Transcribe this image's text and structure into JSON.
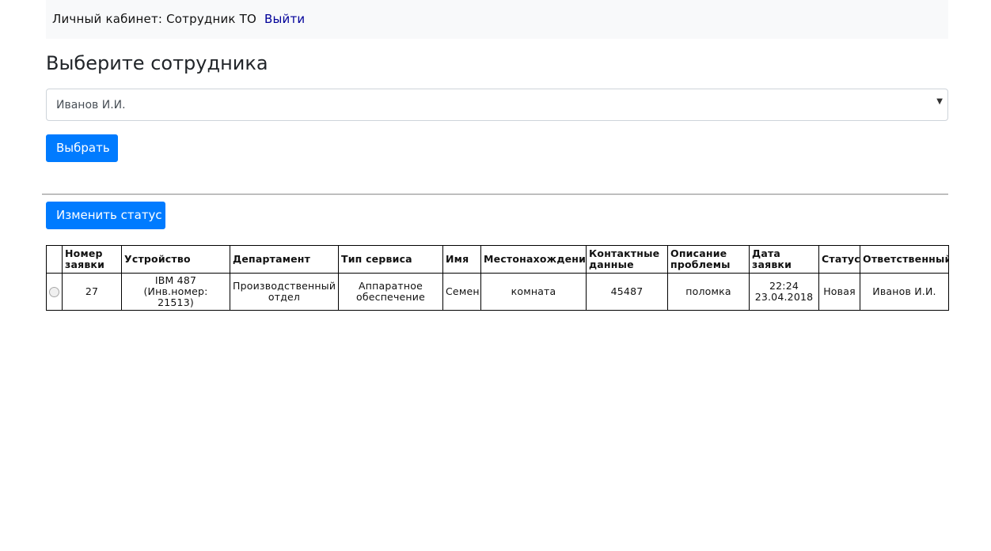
{
  "header": {
    "label": "Личный кабинет: Сотрудник ТО",
    "logout_link": "Выйти"
  },
  "page_title": "Выберите сотрудника",
  "employee_select": {
    "selected": "Иванов И.И."
  },
  "buttons": {
    "select_label": "Выбрать",
    "change_status_label": "Изменить статус"
  },
  "table": {
    "columns": {
      "number": "Номер заявки",
      "device": "Устройство",
      "department": "Департамент",
      "service_type": "Тип сервиса",
      "name": "Имя",
      "location": "Местонахождения",
      "contacts": "Контактные данные",
      "description": "Описание проблемы",
      "date": "Дата заявки",
      "status": "Статус",
      "responsible": "Ответственный"
    },
    "rows": [
      {
        "number": "27",
        "device": "IBM 487 (Инв.номер: 21513)",
        "department": "Производственный отдел",
        "service_type": "Аппаратное обеспечение",
        "name": "Семен",
        "location": "комната",
        "contacts": "45487",
        "description": "поломка",
        "date": "22:24 23.04.2018",
        "status": "Новая",
        "responsible": "Иванов И.И."
      }
    ]
  },
  "colors": {
    "primary_button": "#007bff",
    "header_bg": "#f8f9fa",
    "link": "#000099"
  }
}
